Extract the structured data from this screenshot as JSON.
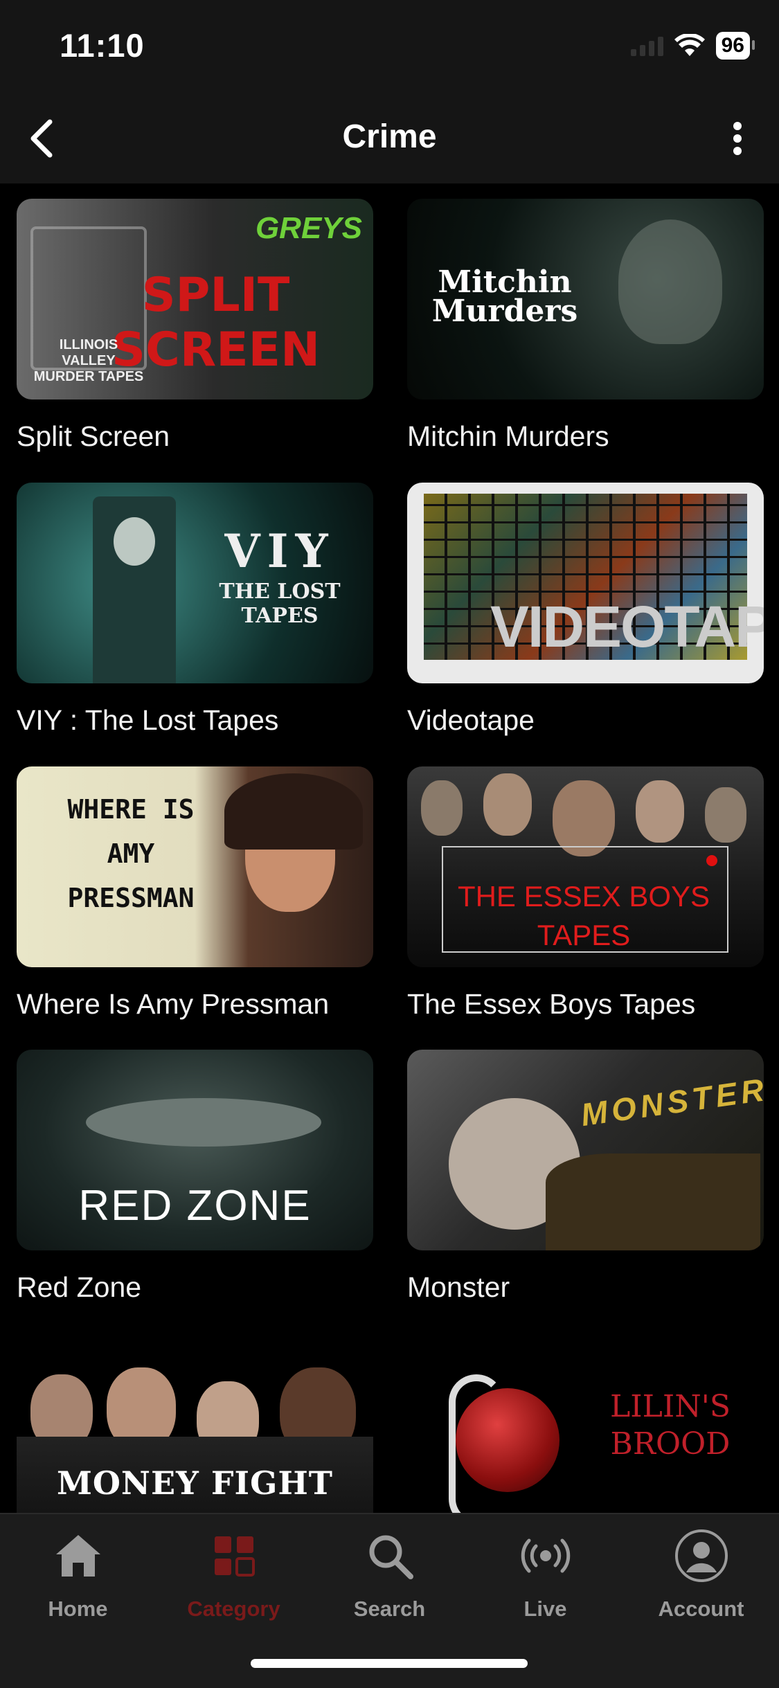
{
  "status": {
    "time": "11:10",
    "battery": "96"
  },
  "header": {
    "title": "Crime"
  },
  "titles": [
    {
      "title": "Split Screen",
      "art": [
        "SPLIT SCREEN",
        "GREYS",
        "ILLINOIS VALLEY MURDER TAPES"
      ]
    },
    {
      "title": "Mitchin Murders",
      "art": [
        "Mitchin Murders"
      ]
    },
    {
      "title": "VIY : The Lost Tapes",
      "art": [
        "VIY",
        "THE LOST TAPES"
      ]
    },
    {
      "title": "Videotape",
      "art": [
        "VIDEOTAPE"
      ]
    },
    {
      "title": "Where Is Amy Pressman",
      "art": [
        "WHERE IS",
        "AMY",
        "PRESSMAN"
      ]
    },
    {
      "title": "The Essex Boys Tapes",
      "art": [
        "THE ESSEX BOYS",
        "TAPES"
      ]
    },
    {
      "title": "Red Zone",
      "art": [
        "RED ZONE"
      ]
    },
    {
      "title": "Monster",
      "art": [
        "MONSTER"
      ]
    },
    {
      "title": "",
      "art": [
        "MONEY FIGHT"
      ]
    },
    {
      "title": "",
      "art": [
        "LILIN'S",
        "BROOD"
      ]
    }
  ],
  "tabs": [
    {
      "label": "Home",
      "icon": "home-icon"
    },
    {
      "label": "Category",
      "icon": "category-icon",
      "active": true
    },
    {
      "label": "Search",
      "icon": "search-icon"
    },
    {
      "label": "Live",
      "icon": "live-icon"
    },
    {
      "label": "Account",
      "icon": "account-icon"
    }
  ],
  "colors": {
    "accent": "#7a1a1a",
    "background": "#000000",
    "bar": "#1c1c1c"
  }
}
